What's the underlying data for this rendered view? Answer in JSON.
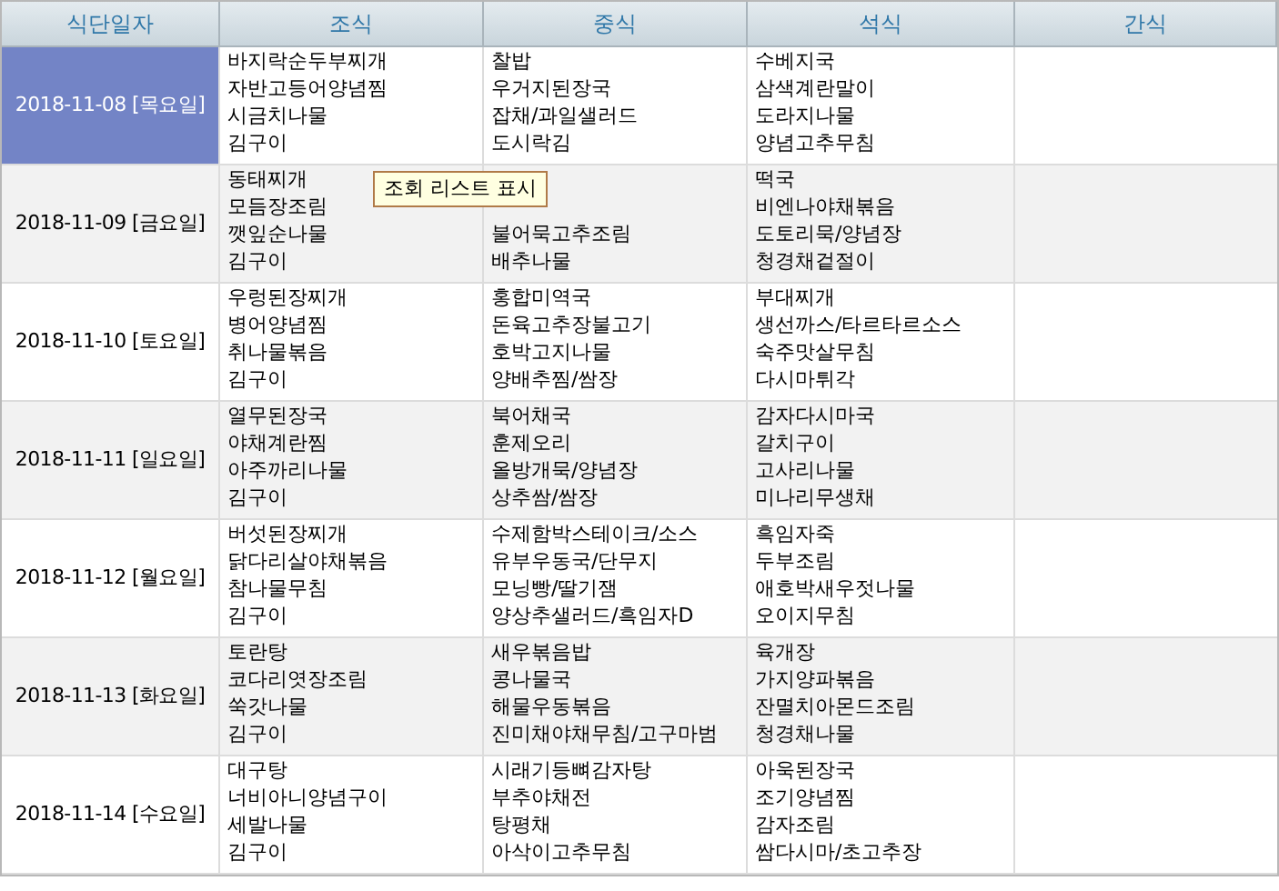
{
  "table": {
    "columns": [
      "식단일자",
      "조식",
      "중식",
      "석식",
      "간식"
    ],
    "rows": [
      {
        "date": "2018-11-08 [목요일]",
        "selected": true,
        "breakfast": [
          "바지락순두부찌개",
          "자반고등어양념찜",
          "시금치나물",
          "김구이"
        ],
        "lunch": [
          "찰밥",
          "우거지된장국",
          "잡채/과일샐러드",
          "도시락김"
        ],
        "dinner": [
          "수베지국",
          "삼색계란말이",
          "도라지나물",
          "양념고추무침"
        ]
      },
      {
        "date": "2018-11-09 [금요일]",
        "selected": false,
        "breakfast": [
          "동태찌개",
          "모듬장조림",
          "깻잎순나물",
          "김구이"
        ],
        "lunch": [
          "불어묵고추조림",
          "배추나물"
        ],
        "dinner": [
          "떡국",
          "비엔나야채볶음",
          "도토리묵/양념장",
          "청경채겉절이"
        ]
      },
      {
        "date": "2018-11-10 [토요일]",
        "selected": false,
        "breakfast": [
          "우렁된장찌개",
          "병어양념찜",
          "취나물볶음",
          "김구이"
        ],
        "lunch": [
          "홍합미역국",
          "돈육고추장불고기",
          "호박고지나물",
          "양배추찜/쌈장"
        ],
        "dinner": [
          "부대찌개",
          "생선까스/타르타르소스",
          "숙주맛살무침",
          "다시마튀각"
        ]
      },
      {
        "date": "2018-11-11 [일요일]",
        "selected": false,
        "breakfast": [
          "열무된장국",
          "야채계란찜",
          "아주까리나물",
          "김구이"
        ],
        "lunch": [
          "북어채국",
          "훈제오리",
          "올방개묵/양념장",
          "상추쌈/쌈장"
        ],
        "dinner": [
          "감자다시마국",
          "갈치구이",
          "고사리나물",
          "미나리무생채"
        ]
      },
      {
        "date": "2018-11-12 [월요일]",
        "selected": false,
        "breakfast": [
          "버섯된장찌개",
          "닭다리살야채볶음",
          "참나물무침",
          "김구이"
        ],
        "lunch": [
          "수제함박스테이크/소스",
          "유부우동국/단무지",
          "모닝빵/딸기잼",
          "양상추샐러드/흑임자D"
        ],
        "dinner": [
          "흑임자죽",
          "두부조림",
          "애호박새우젓나물",
          "오이지무침"
        ]
      },
      {
        "date": "2018-11-13 [화요일]",
        "selected": false,
        "breakfast": [
          "토란탕",
          "코다리엿장조림",
          "쑥갓나물",
          "김구이"
        ],
        "lunch": [
          "새우볶음밥",
          "콩나물국",
          "해물우동볶음",
          "진미채야채무침/고구마범"
        ],
        "dinner": [
          "육개장",
          "가지양파볶음",
          "잔멸치아몬드조림",
          "청경채나물"
        ]
      },
      {
        "date": "2018-11-14 [수요일]",
        "selected": false,
        "breakfast": [
          "대구탕",
          "너비아니양념구이",
          "세발나물",
          "김구이"
        ],
        "lunch": [
          "시래기등뼈감자탕",
          "부추야채전",
          "탕평채",
          "아삭이고추무침"
        ],
        "dinner": [
          "아욱된장국",
          "조기양념찜",
          "감자조림",
          "쌈다시마/초고추장"
        ]
      }
    ]
  },
  "tooltip": {
    "text": "조회 리스트 표시"
  }
}
